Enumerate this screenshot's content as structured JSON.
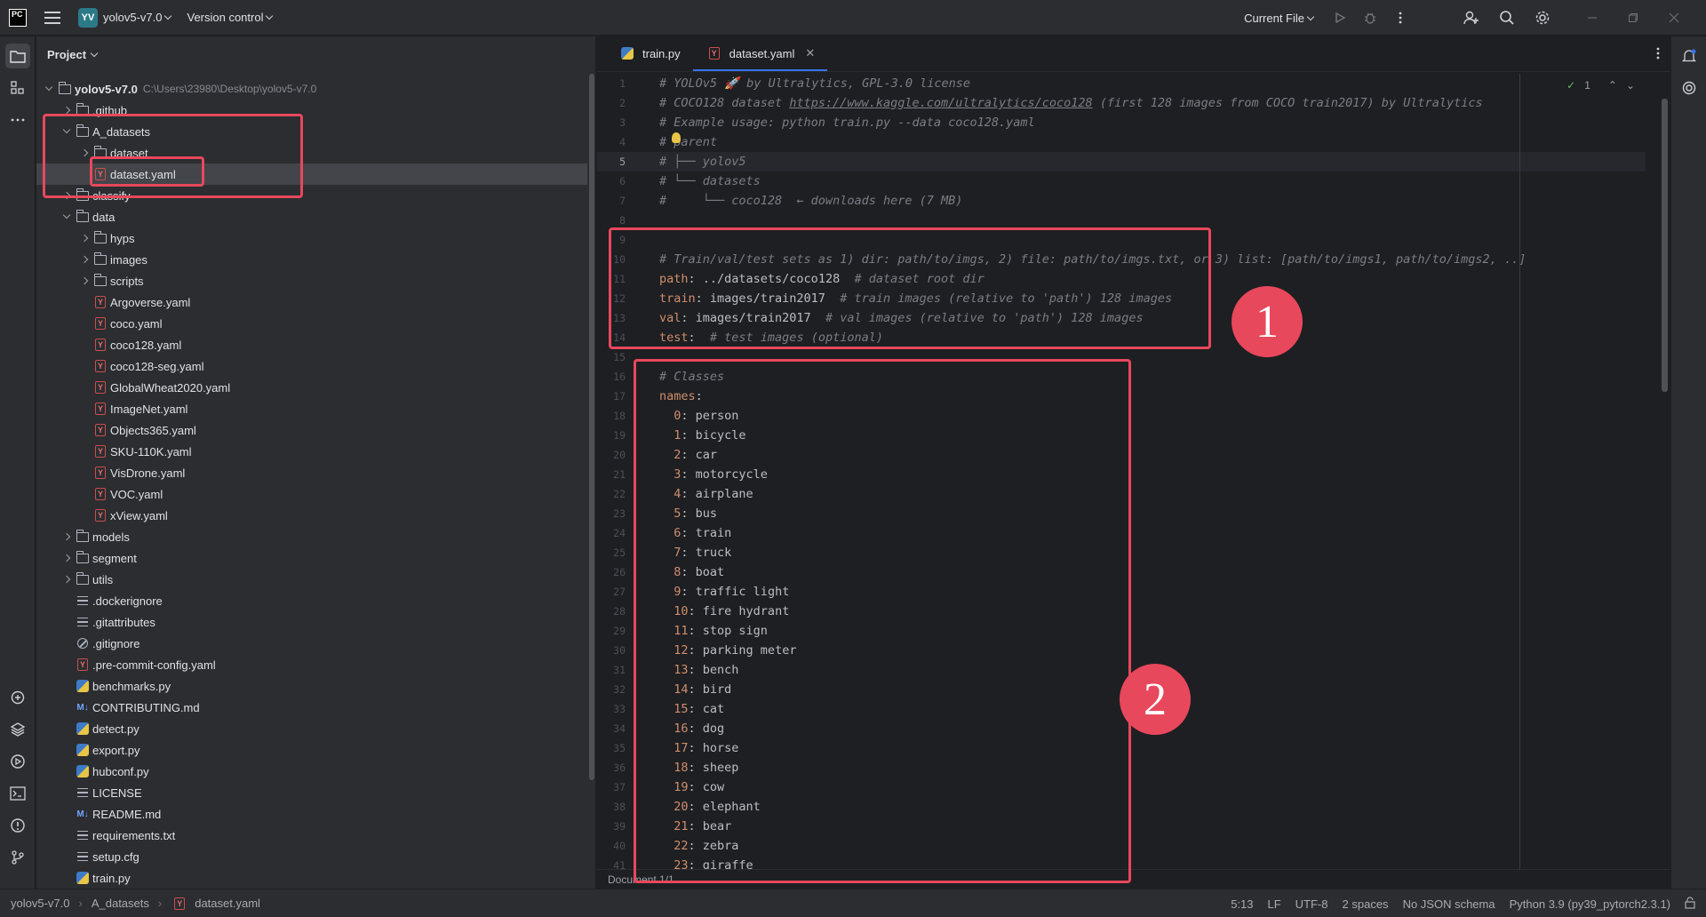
{
  "titlebar": {
    "project_badge": "YV",
    "project_name": "yolov5-v7.0",
    "vcs": "Version control",
    "run_config": "Current File"
  },
  "project_panel": {
    "title": "Project",
    "root_name": "yolov5-v7.0",
    "root_path": "C:\\Users\\23980\\Desktop\\yolov5-v7.0",
    "items": [
      {
        "label": ".github",
        "kind": "folder",
        "depth": 1,
        "expanded": false
      },
      {
        "label": "A_datasets",
        "kind": "folder",
        "depth": 1,
        "expanded": true
      },
      {
        "label": "dataset",
        "kind": "folder",
        "depth": 2,
        "expanded": false
      },
      {
        "label": "dataset.yaml",
        "kind": "yaml",
        "depth": 2,
        "selected": true
      },
      {
        "label": "classify",
        "kind": "folder",
        "depth": 1,
        "expanded": false
      },
      {
        "label": "data",
        "kind": "folder",
        "depth": 1,
        "expanded": true
      },
      {
        "label": "hyps",
        "kind": "folder",
        "depth": 2,
        "expanded": false
      },
      {
        "label": "images",
        "kind": "folder",
        "depth": 2,
        "expanded": false
      },
      {
        "label": "scripts",
        "kind": "folder",
        "depth": 2,
        "expanded": false
      },
      {
        "label": "Argoverse.yaml",
        "kind": "yaml",
        "depth": 2
      },
      {
        "label": "coco.yaml",
        "kind": "yaml",
        "depth": 2
      },
      {
        "label": "coco128.yaml",
        "kind": "yaml",
        "depth": 2
      },
      {
        "label": "coco128-seg.yaml",
        "kind": "yaml",
        "depth": 2
      },
      {
        "label": "GlobalWheat2020.yaml",
        "kind": "yaml",
        "depth": 2
      },
      {
        "label": "ImageNet.yaml",
        "kind": "yaml",
        "depth": 2
      },
      {
        "label": "Objects365.yaml",
        "kind": "yaml",
        "depth": 2
      },
      {
        "label": "SKU-110K.yaml",
        "kind": "yaml",
        "depth": 2
      },
      {
        "label": "VisDrone.yaml",
        "kind": "yaml",
        "depth": 2
      },
      {
        "label": "VOC.yaml",
        "kind": "yaml",
        "depth": 2
      },
      {
        "label": "xView.yaml",
        "kind": "yaml",
        "depth": 2
      },
      {
        "label": "models",
        "kind": "folder",
        "depth": 1,
        "expanded": false
      },
      {
        "label": "segment",
        "kind": "folder",
        "depth": 1,
        "expanded": false
      },
      {
        "label": "utils",
        "kind": "folder",
        "depth": 1,
        "expanded": false
      },
      {
        "label": ".dockerignore",
        "kind": "text",
        "depth": 1
      },
      {
        "label": ".gitattributes",
        "kind": "text",
        "depth": 1
      },
      {
        "label": ".gitignore",
        "kind": "ignore",
        "depth": 1
      },
      {
        "label": ".pre-commit-config.yaml",
        "kind": "yaml",
        "depth": 1
      },
      {
        "label": "benchmarks.py",
        "kind": "python",
        "depth": 1
      },
      {
        "label": "CONTRIBUTING.md",
        "kind": "markdown",
        "depth": 1
      },
      {
        "label": "detect.py",
        "kind": "python",
        "depth": 1
      },
      {
        "label": "export.py",
        "kind": "python",
        "depth": 1
      },
      {
        "label": "hubconf.py",
        "kind": "python",
        "depth": 1
      },
      {
        "label": "LICENSE",
        "kind": "text",
        "depth": 1
      },
      {
        "label": "README.md",
        "kind": "markdown",
        "depth": 1
      },
      {
        "label": "requirements.txt",
        "kind": "text",
        "depth": 1
      },
      {
        "label": "setup.cfg",
        "kind": "text",
        "depth": 1
      },
      {
        "label": "train.py",
        "kind": "python",
        "depth": 1
      }
    ]
  },
  "editor": {
    "tabs": [
      {
        "label": "train.py",
        "kind": "python",
        "active": false
      },
      {
        "label": "dataset.yaml",
        "kind": "yaml",
        "active": true
      }
    ],
    "inspection_count": "1",
    "caret_line": 5,
    "lines": [
      [
        [
          "c-com",
          "# YOLOv5 🚀 by Ultralytics, GPL-3.0 license"
        ]
      ],
      [
        [
          "c-com",
          "# COCO128 dataset "
        ],
        [
          "c-link",
          "https://www.kaggle.com/ultralytics/coco128"
        ],
        [
          "c-com",
          " (first 128 images from COCO train2017) by Ultralytics"
        ]
      ],
      [
        [
          "c-com",
          "# Example usage: python train.py --data coco128.yaml"
        ]
      ],
      [
        [
          "c-com",
          "# parent"
        ]
      ],
      [
        [
          "c-com",
          "# ├── yolov5"
        ]
      ],
      [
        [
          "c-com",
          "# └── datasets"
        ]
      ],
      [
        [
          "c-com",
          "#     └── coco128  ← downloads here (7 MB)"
        ]
      ],
      [],
      [],
      [
        [
          "c-com",
          "# Train/val/test sets as 1) dir: path/to/imgs, 2) file: path/to/imgs.txt, or 3) list: [path/to/imgs1, path/to/imgs2, ..]"
        ]
      ],
      [
        [
          "c-key",
          "path"
        ],
        [
          "c-val",
          ": ../datasets/coco128  "
        ],
        [
          "c-com",
          "# dataset root dir"
        ]
      ],
      [
        [
          "c-key",
          "train"
        ],
        [
          "c-val",
          ": images/train2017  "
        ],
        [
          "c-com",
          "# train images (relative to 'path') 128 images"
        ]
      ],
      [
        [
          "c-key",
          "val"
        ],
        [
          "c-val",
          ": images/train2017  "
        ],
        [
          "c-com",
          "# val images (relative to 'path') 128 images"
        ]
      ],
      [
        [
          "c-key",
          "test"
        ],
        [
          "c-val",
          ":  "
        ],
        [
          "c-com",
          "# test images (optional)"
        ]
      ],
      [],
      [
        [
          "c-com",
          "# Classes"
        ]
      ],
      [
        [
          "c-key",
          "names"
        ],
        [
          "c-val",
          ":"
        ]
      ],
      [
        [
          "c-val",
          "  "
        ],
        [
          "c-key",
          "0"
        ],
        [
          "c-val",
          ": person"
        ]
      ],
      [
        [
          "c-val",
          "  "
        ],
        [
          "c-key",
          "1"
        ],
        [
          "c-val",
          ": bicycle"
        ]
      ],
      [
        [
          "c-val",
          "  "
        ],
        [
          "c-key",
          "2"
        ],
        [
          "c-val",
          ": car"
        ]
      ],
      [
        [
          "c-val",
          "  "
        ],
        [
          "c-key",
          "3"
        ],
        [
          "c-val",
          ": motorcycle"
        ]
      ],
      [
        [
          "c-val",
          "  "
        ],
        [
          "c-key",
          "4"
        ],
        [
          "c-val",
          ": airplane"
        ]
      ],
      [
        [
          "c-val",
          "  "
        ],
        [
          "c-key",
          "5"
        ],
        [
          "c-val",
          ": bus"
        ]
      ],
      [
        [
          "c-val",
          "  "
        ],
        [
          "c-key",
          "6"
        ],
        [
          "c-val",
          ": train"
        ]
      ],
      [
        [
          "c-val",
          "  "
        ],
        [
          "c-key",
          "7"
        ],
        [
          "c-val",
          ": truck"
        ]
      ],
      [
        [
          "c-val",
          "  "
        ],
        [
          "c-key",
          "8"
        ],
        [
          "c-val",
          ": boat"
        ]
      ],
      [
        [
          "c-val",
          "  "
        ],
        [
          "c-key",
          "9"
        ],
        [
          "c-val",
          ": traffic light"
        ]
      ],
      [
        [
          "c-val",
          "  "
        ],
        [
          "c-key",
          "10"
        ],
        [
          "c-val",
          ": fire hydrant"
        ]
      ],
      [
        [
          "c-val",
          "  "
        ],
        [
          "c-key",
          "11"
        ],
        [
          "c-val",
          ": stop sign"
        ]
      ],
      [
        [
          "c-val",
          "  "
        ],
        [
          "c-key",
          "12"
        ],
        [
          "c-val",
          ": parking meter"
        ]
      ],
      [
        [
          "c-val",
          "  "
        ],
        [
          "c-key",
          "13"
        ],
        [
          "c-val",
          ": bench"
        ]
      ],
      [
        [
          "c-val",
          "  "
        ],
        [
          "c-key",
          "14"
        ],
        [
          "c-val",
          ": bird"
        ]
      ],
      [
        [
          "c-val",
          "  "
        ],
        [
          "c-key",
          "15"
        ],
        [
          "c-val",
          ": cat"
        ]
      ],
      [
        [
          "c-val",
          "  "
        ],
        [
          "c-key",
          "16"
        ],
        [
          "c-val",
          ": dog"
        ]
      ],
      [
        [
          "c-val",
          "  "
        ],
        [
          "c-key",
          "17"
        ],
        [
          "c-val",
          ": horse"
        ]
      ],
      [
        [
          "c-val",
          "  "
        ],
        [
          "c-key",
          "18"
        ],
        [
          "c-val",
          ": sheep"
        ]
      ],
      [
        [
          "c-val",
          "  "
        ],
        [
          "c-key",
          "19"
        ],
        [
          "c-val",
          ": cow"
        ]
      ],
      [
        [
          "c-val",
          "  "
        ],
        [
          "c-key",
          "20"
        ],
        [
          "c-val",
          ": elephant"
        ]
      ],
      [
        [
          "c-val",
          "  "
        ],
        [
          "c-key",
          "21"
        ],
        [
          "c-val",
          ": bear"
        ]
      ],
      [
        [
          "c-val",
          "  "
        ],
        [
          "c-key",
          "22"
        ],
        [
          "c-val",
          ": zebra"
        ]
      ],
      [
        [
          "c-val",
          "  "
        ],
        [
          "c-key",
          "23"
        ],
        [
          "c-val",
          ": giraffe"
        ]
      ]
    ],
    "document_label": "Document 1/1"
  },
  "annotations": {
    "num1": "1",
    "num2": "2",
    "color": "#e8485c"
  },
  "statusbar": {
    "crumbs": [
      "yolov5-v7.0",
      "A_datasets",
      "dataset.yaml"
    ],
    "position": "5:13",
    "line_sep": "LF",
    "encoding": "UTF-8",
    "indent": "2 spaces",
    "schema": "No JSON schema",
    "interpreter": "Python 3.9 (py39_pytorch2.3.1)"
  },
  "icons": {
    "hamburger": "menu-icon",
    "run": "run-icon",
    "debug": "debug-icon",
    "more": "more-vertical-icon",
    "add_user": "add-user-icon",
    "search": "search-icon",
    "settings": "gear-icon",
    "minimize": "minimize-icon",
    "restore": "restore-icon",
    "close": "close-icon"
  }
}
